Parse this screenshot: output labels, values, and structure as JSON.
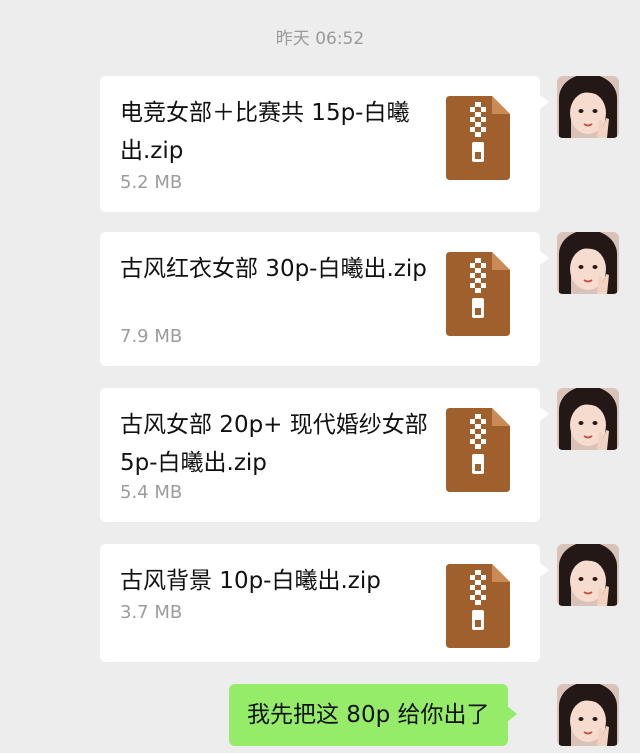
{
  "timestamp": "昨天 06:52",
  "colors": {
    "background": "#ededed",
    "bubble_green": "#95ec69",
    "zip_icon": "#a0602e"
  },
  "messages": [
    {
      "type": "file",
      "name": "电竞女部＋比赛共 15p-白曦出.zip",
      "size": "5.2 MB",
      "icon": "zip-file-icon"
    },
    {
      "type": "file",
      "name": "古风红衣女部 30p-白曦出.zip",
      "size": "7.9 MB",
      "icon": "zip-file-icon"
    },
    {
      "type": "file",
      "name": "古风女部 20p+ 现代婚纱女部 5p-白曦出.zip",
      "size": "5.4 MB",
      "icon": "zip-file-icon"
    },
    {
      "type": "file",
      "name": "古风背景 10p-白曦出.zip",
      "size": "3.7 MB",
      "icon": "zip-file-icon"
    },
    {
      "type": "text",
      "text": "我先把这 80p 给你出了"
    }
  ]
}
